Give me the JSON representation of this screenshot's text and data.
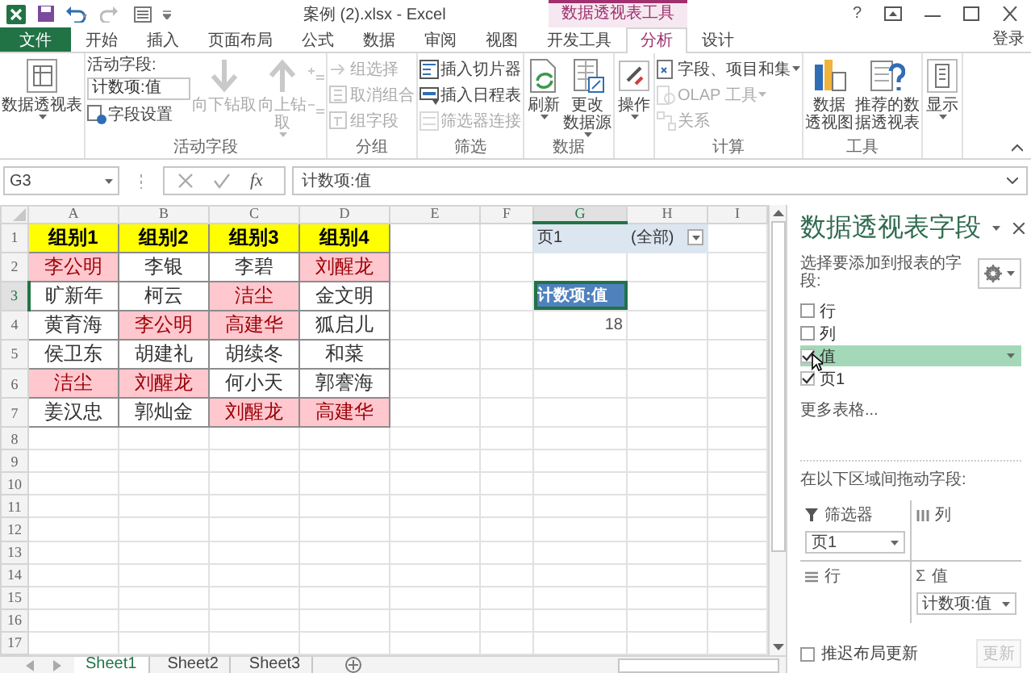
{
  "window": {
    "title": "案例 (2).xlsx - Excel",
    "context_label": "数据透视表工具",
    "help": "?"
  },
  "tabs": [
    {
      "label": "文件",
      "kind": "file",
      "selected": false
    },
    {
      "label": "开始",
      "kind": "tab",
      "selected": false
    },
    {
      "label": "插入",
      "kind": "tab",
      "selected": false
    },
    {
      "label": "页面布局",
      "kind": "tab",
      "selected": false
    },
    {
      "label": "公式",
      "kind": "tab",
      "selected": false
    },
    {
      "label": "数据",
      "kind": "tab",
      "selected": false
    },
    {
      "label": "审阅",
      "kind": "tab",
      "selected": false
    },
    {
      "label": "视图",
      "kind": "tab",
      "selected": false
    },
    {
      "label": "开发工具",
      "kind": "tab",
      "selected": false
    },
    {
      "label": "分析",
      "kind": "context",
      "selected": true
    },
    {
      "label": "设计",
      "kind": "context",
      "selected": false
    }
  ],
  "account": "登录",
  "ribbon": [
    {
      "columns": [
        [
          {
            "kind": "large",
            "lines": [
              "数据透视表"
            ],
            "dropdown": true,
            "disabled": false
          }
        ]
      ]
    },
    {
      "label": "活动字段",
      "columns": [
        [
          {
            "kind": "field",
            "label": "活动字段:",
            "value": "计数项:值"
          },
          {
            "kind": "small",
            "label": "字段设置",
            "dropdown": false,
            "disabled": false
          }
        ],
        [
          {
            "kind": "large",
            "lines": [
              "向下钻取"
            ],
            "dropdown": false,
            "disabled": true
          }
        ],
        [
          {
            "kind": "large",
            "lines": [
              "向上钻",
              "取"
            ],
            "dropdown": true,
            "disabled": true
          }
        ],
        [
          {
            "kind": "mini",
            "disabled": true
          },
          {
            "kind": "mini",
            "disabled": true
          }
        ]
      ]
    },
    {
      "label": "分组",
      "columns": [
        [
          {
            "kind": "small",
            "label": "组选择",
            "dropdown": false,
            "disabled": true
          },
          {
            "kind": "small",
            "label": "取消组合",
            "dropdown": false,
            "disabled": true
          },
          {
            "kind": "small",
            "label": "组字段",
            "dropdown": false,
            "disabled": true
          }
        ]
      ]
    },
    {
      "label": "筛选",
      "columns": [
        [
          {
            "kind": "small",
            "label": "插入切片器",
            "dropdown": false,
            "disabled": false
          },
          {
            "kind": "small",
            "label": "插入日程表",
            "dropdown": false,
            "disabled": false
          },
          {
            "kind": "small",
            "label": "筛选器连接",
            "dropdown": false,
            "disabled": true
          }
        ]
      ]
    },
    {
      "label": "数据",
      "columns": [
        [
          {
            "kind": "large",
            "lines": [
              "刷新"
            ],
            "dropdown": true,
            "disabled": false
          }
        ],
        [
          {
            "kind": "large",
            "lines": [
              "更改",
              "数据源"
            ],
            "dropdown": true,
            "disabled": false
          }
        ]
      ]
    },
    {
      "columns": [
        [
          {
            "kind": "large",
            "lines": [
              "操作"
            ],
            "dropdown": true,
            "disabled": false
          }
        ]
      ]
    },
    {
      "label": "计算",
      "columns": [
        [
          {
            "kind": "small",
            "label": "字段、项目和集",
            "dropdown": true,
            "disabled": false
          },
          {
            "kind": "small",
            "label": "OLAP 工具",
            "dropdown": true,
            "disabled": true
          },
          {
            "kind": "small",
            "label": "关系",
            "dropdown": false,
            "disabled": true
          }
        ]
      ]
    },
    {
      "label": "工具",
      "columns": [
        [
          {
            "kind": "large",
            "lines": [
              "数据",
              "透视图"
            ],
            "dropdown": false,
            "disabled": false
          }
        ],
        [
          {
            "kind": "large",
            "lines": [
              "推荐的数",
              "据透视表"
            ],
            "dropdown": false,
            "disabled": false
          }
        ]
      ]
    },
    {
      "columns": [
        [
          {
            "kind": "large",
            "lines": [
              "显示"
            ],
            "dropdown": true,
            "disabled": false
          }
        ]
      ]
    }
  ],
  "formula_bar": {
    "name_box": "G3",
    "function_label": "fx",
    "formula": "计数项:值"
  },
  "sheet": {
    "columns": [
      {
        "label": "A",
        "selected": false
      },
      {
        "label": "B",
        "selected": false
      },
      {
        "label": "C",
        "selected": false
      },
      {
        "label": "D",
        "selected": false
      },
      {
        "label": "E",
        "selected": false
      },
      {
        "label": "F",
        "selected": false
      },
      {
        "label": "G",
        "selected": true
      },
      {
        "label": "H",
        "selected": false
      },
      {
        "label": "I",
        "selected": false
      }
    ],
    "row_numbers": [
      {
        "label": "1",
        "selected": false
      },
      {
        "label": "2",
        "selected": false
      },
      {
        "label": "3",
        "selected": true
      },
      {
        "label": "4",
        "selected": false
      },
      {
        "label": "5",
        "selected": false
      },
      {
        "label": "6",
        "selected": false
      },
      {
        "label": "7",
        "selected": false
      },
      {
        "label": "8",
        "selected": false
      },
      {
        "label": "9",
        "selected": false
      },
      {
        "label": "10",
        "selected": false
      },
      {
        "label": "11",
        "selected": false
      },
      {
        "label": "12",
        "selected": false
      },
      {
        "label": "13",
        "selected": false
      },
      {
        "label": "14",
        "selected": false
      },
      {
        "label": "15",
        "selected": false
      },
      {
        "label": "16",
        "selected": false
      },
      {
        "label": "17",
        "selected": false
      }
    ],
    "rows": [
      [
        {
          "text": "组别1",
          "kind": "header"
        },
        {
          "text": "组别2",
          "kind": "header"
        },
        {
          "text": "组别3",
          "kind": "header"
        },
        {
          "text": "组别4",
          "kind": "header"
        }
      ],
      [
        {
          "text": "李公明",
          "kind": "cell",
          "highlighted": true
        },
        {
          "text": "李银",
          "kind": "cell",
          "highlighted": false
        },
        {
          "text": "李碧",
          "kind": "cell",
          "highlighted": false
        },
        {
          "text": "刘醒龙",
          "kind": "cell",
          "highlighted": true
        }
      ],
      [
        {
          "text": "旷新年",
          "kind": "cell",
          "highlighted": false
        },
        {
          "text": "柯云",
          "kind": "cell",
          "highlighted": false
        },
        {
          "text": "洁尘",
          "kind": "cell",
          "highlighted": true
        },
        {
          "text": "金文明",
          "kind": "cell",
          "highlighted": false
        }
      ],
      [
        {
          "text": "黄育海",
          "kind": "cell",
          "highlighted": false
        },
        {
          "text": "李公明",
          "kind": "cell",
          "highlighted": true
        },
        {
          "text": "高建华",
          "kind": "cell",
          "highlighted": true
        },
        {
          "text": "狐启儿",
          "kind": "cell",
          "highlighted": false
        }
      ],
      [
        {
          "text": "侯卫东",
          "kind": "cell",
          "highlighted": false
        },
        {
          "text": "胡建礼",
          "kind": "cell",
          "highlighted": false
        },
        {
          "text": "胡续冬",
          "kind": "cell",
          "highlighted": false
        },
        {
          "text": "和菜",
          "kind": "cell",
          "highlighted": false
        }
      ],
      [
        {
          "text": "洁尘",
          "kind": "cell",
          "highlighted": true
        },
        {
          "text": "刘醒龙",
          "kind": "cell",
          "highlighted": true
        },
        {
          "text": "何小天",
          "kind": "cell",
          "highlighted": false
        },
        {
          "text": "郭謇海",
          "kind": "cell",
          "highlighted": false
        }
      ],
      [
        {
          "text": "姜汉忠",
          "kind": "cell",
          "highlighted": false
        },
        {
          "text": "郭灿金",
          "kind": "cell",
          "highlighted": false
        },
        {
          "text": "刘醒龙",
          "kind": "cell",
          "highlighted": true
        },
        {
          "text": "高建华",
          "kind": "cell",
          "highlighted": true
        }
      ]
    ],
    "pivot": {
      "filter_label": "页1",
      "filter_value": "(全部)",
      "value_header": "计数项:值",
      "value_header_selected": true,
      "value": "18"
    },
    "sheet_tabs": [
      {
        "label": "Sheet1",
        "selected": true
      },
      {
        "label": "Sheet2",
        "selected": false
      },
      {
        "label": "Sheet3",
        "selected": false
      }
    ]
  },
  "panel": {
    "title": "数据透视表字段",
    "prompt": "选择要添加到报表的字段:",
    "fields": [
      {
        "label": "行",
        "checked": false,
        "selected": false
      },
      {
        "label": "列",
        "checked": false,
        "selected": false
      },
      {
        "label": "值",
        "checked": true,
        "selected": true
      },
      {
        "label": "页1",
        "checked": true,
        "selected": false
      }
    ],
    "more": "更多表格...",
    "areas_prompt": "在以下区域间拖动字段:",
    "areas": [
      {
        "kind": "filter",
        "label": "筛选器",
        "items": [
          "页1"
        ]
      },
      {
        "kind": "columns",
        "label": "列"
      },
      {
        "kind": "rows",
        "label": "行"
      },
      {
        "kind": "values",
        "symbol": "Σ",
        "label": "值",
        "items": [
          "计数项:值"
        ]
      }
    ],
    "defer": {
      "label": "推迟布局更新",
      "checked": false
    },
    "update_button": {
      "label": "更新",
      "disabled": true
    }
  }
}
